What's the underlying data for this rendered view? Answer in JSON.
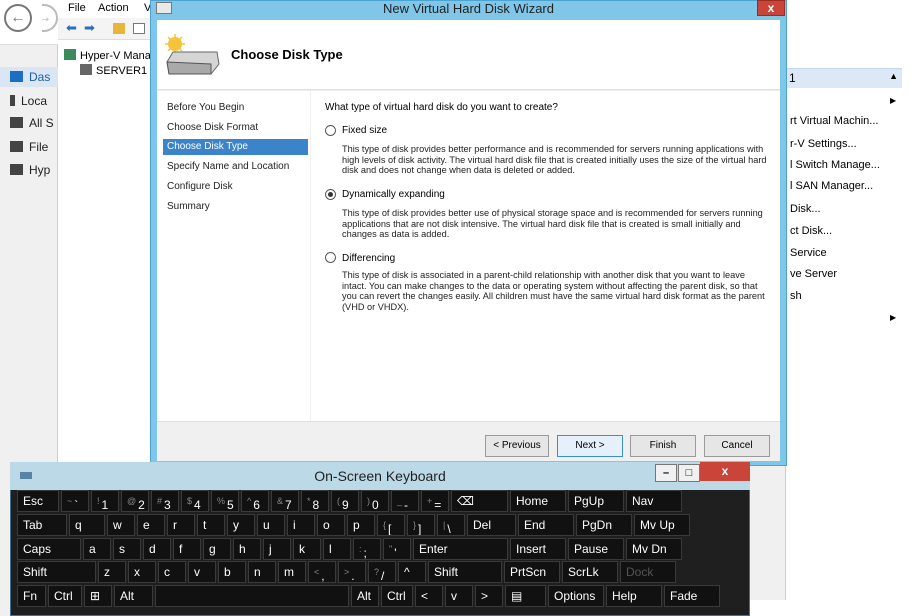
{
  "server_manager": {
    "sidebar": [
      {
        "label": "Das",
        "selected": true
      },
      {
        "label": "Loca"
      },
      {
        "label": "All S"
      },
      {
        "label": "File"
      },
      {
        "label": "Hyp"
      }
    ]
  },
  "hyperv": {
    "menu": [
      "File",
      "Action",
      "V"
    ],
    "tree": [
      "Hyper-V Mana",
      "SERVER1"
    ]
  },
  "actions": {
    "header": "1",
    "items": [
      "rt Virtual Machin...",
      "r-V Settings...",
      "l Switch Manage...",
      "l SAN Manager...",
      "Disk...",
      "ct Disk...",
      "Service",
      "ve Server",
      "sh"
    ]
  },
  "wizard": {
    "title": "New Virtual Hard Disk Wizard",
    "close": "x",
    "heading": "Choose Disk Type",
    "nav": [
      "Before You Begin",
      "Choose Disk Format",
      "Choose Disk Type",
      "Specify Name and Location",
      "Configure Disk",
      "Summary"
    ],
    "selected_nav": 2,
    "question": "What type of virtual hard disk do you want to create?",
    "options": [
      {
        "label": "Fixed size",
        "checked": false,
        "desc": "This type of disk provides better performance and is recommended for servers running applications with high levels of disk activity. The virtual hard disk file that is created initially uses the size of the virtual hard disk and does not change when data is deleted or added."
      },
      {
        "label": "Dynamically expanding",
        "checked": true,
        "desc": "This type of disk provides better use of physical storage space and is recommended for servers running applications that are not disk intensive. The virtual hard disk file that is created is small initially and changes as data is added."
      },
      {
        "label": "Differencing",
        "checked": false,
        "desc": "This type of disk is associated in a parent-child relationship with another disk that you want to leave intact. You can make changes to the data or operating system without affecting the parent disk, so that you can revert the changes easily. All children must have the same virtual hard disk format as the parent (VHD or VHDX)."
      }
    ],
    "buttons": {
      "previous": "< Previous",
      "next": "Next >",
      "finish": "Finish",
      "cancel": "Cancel"
    }
  },
  "keyboard": {
    "title": "On-Screen Keyboard",
    "window_buttons": {
      "minimize": "–",
      "maximize": "□",
      "close": "x"
    },
    "rows": [
      [
        "Esc",
        "~ `",
        "! 1",
        "@ 2",
        "# 3",
        "$ 4",
        "% 5",
        "^ 6",
        "& 7",
        "* 8",
        "( 9",
        ") 0",
        "_ -",
        "+ =",
        "⌫",
        "Home",
        "PgUp",
        "Nav"
      ],
      [
        "Tab",
        "q",
        "w",
        "e",
        "r",
        "t",
        "y",
        "u",
        "i",
        "o",
        "p",
        "{ [",
        "} ]",
        "| \\",
        "Del",
        "End",
        "PgDn",
        "Mv Up"
      ],
      [
        "Caps",
        "a",
        "s",
        "d",
        "f",
        "g",
        "h",
        "j",
        "k",
        "l",
        ": ;",
        "\" '",
        "Enter",
        "Insert",
        "Pause",
        "Mv Dn"
      ],
      [
        "Shift",
        "z",
        "x",
        "c",
        "v",
        "b",
        "n",
        "m",
        "< ,",
        "> .",
        "? /",
        "^",
        "Shift",
        "PrtScn",
        "ScrLk",
        "Dock"
      ],
      [
        "Fn",
        "Ctrl",
        "⊞",
        "Alt",
        "",
        "Alt",
        "Ctrl",
        "<",
        "v",
        ">",
        "▤",
        "Options",
        "Help",
        "Fade"
      ]
    ]
  }
}
